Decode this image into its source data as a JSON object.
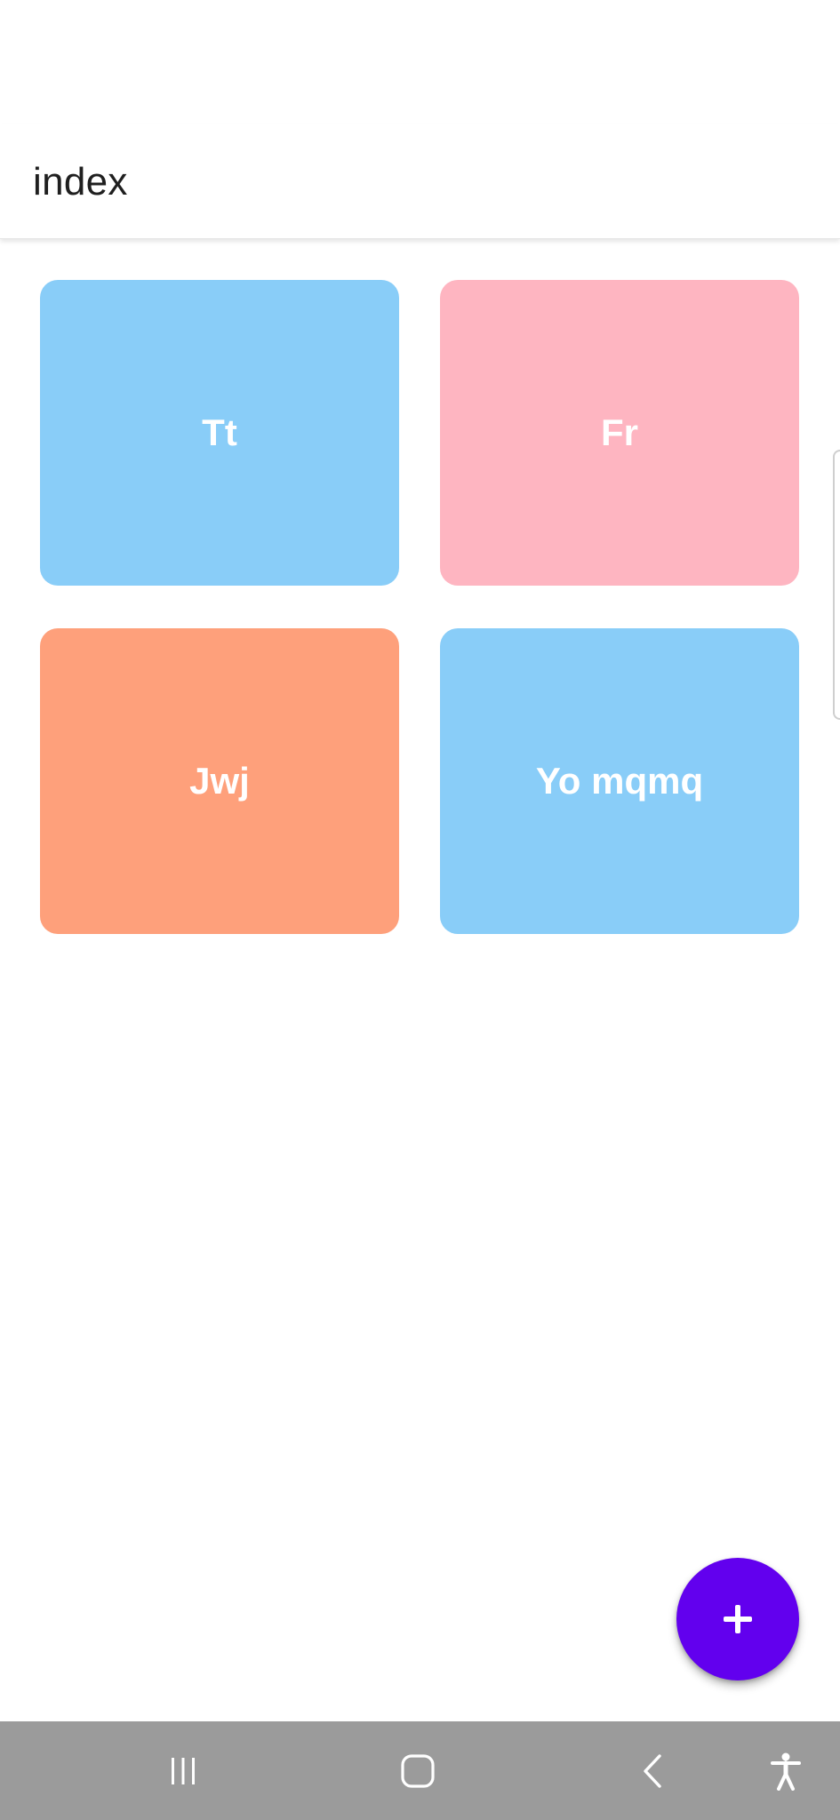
{
  "app_bar": {
    "title": "index"
  },
  "cards": [
    {
      "label": "Tt",
      "color": "#89cdf8"
    },
    {
      "label": "Fr",
      "color": "#feb5c1"
    },
    {
      "label": "Jwj",
      "color": "#fea07b"
    },
    {
      "label": "Yo mqmq",
      "color": "#89cdf8"
    }
  ],
  "fab": {
    "icon": "plus-icon",
    "color": "#6200ee"
  },
  "nav_bar": {
    "color": "#9b9b9b",
    "buttons": [
      {
        "icon": "recents-icon"
      },
      {
        "icon": "home-icon"
      },
      {
        "icon": "back-icon"
      },
      {
        "icon": "accessibility-icon"
      }
    ]
  }
}
